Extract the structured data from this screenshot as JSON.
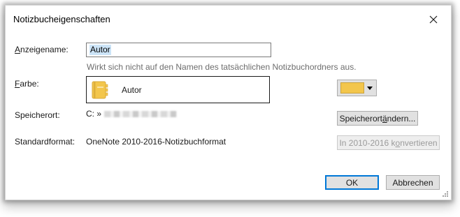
{
  "dialog": {
    "title": "Notizbucheigenschaften",
    "close_icon": "close-icon"
  },
  "display_name": {
    "label_prefix": "",
    "label_accel": "A",
    "label_rest": "nzeigename:",
    "value": "Autor",
    "hint": "Wirkt sich nicht auf den Namen des tatsächlichen Notizbuchordners aus."
  },
  "color": {
    "label_accel": "F",
    "label_rest": "arbe:",
    "preview_name": "Autor",
    "notebook_icon": "notebook-icon",
    "swatch_color": "#f3c64c",
    "dropdown_icon": "caret-down-icon"
  },
  "location": {
    "label": "Speicherort:",
    "path_prefix": "C: »",
    "button_pre": "Speicherort ",
    "button_accel": "ä",
    "button_post": "ndern..."
  },
  "format": {
    "label": "Standardformat:",
    "value": "OneNote 2010-2016-Notizbuchformat",
    "button_pre": "In 2010-2016 k",
    "button_accel": "o",
    "button_post": "nvertieren"
  },
  "footer": {
    "ok_label": "OK",
    "cancel_label": "Abbrechen"
  }
}
